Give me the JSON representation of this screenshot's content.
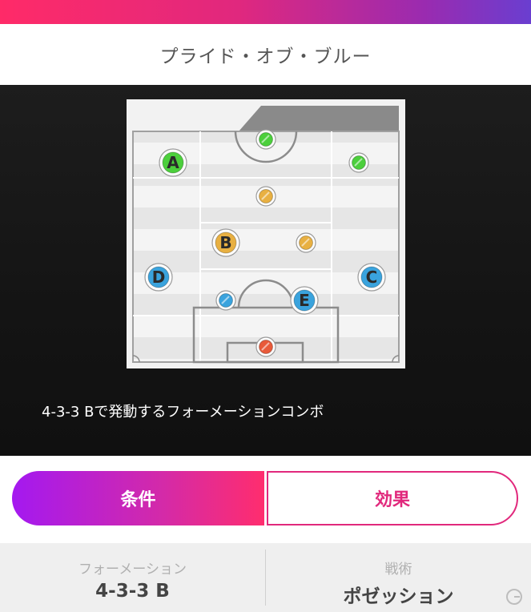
{
  "header": {
    "title": "プライド・オブ・ブルー"
  },
  "formation_preview": {
    "description": "4-3-3 Bで発動するフォーメーションコンボ",
    "players": [
      {
        "label": "",
        "color": "#4ccf3c"
      },
      {
        "label": "A",
        "color": "#4ccf3c"
      },
      {
        "label": "",
        "color": "#4ccf3c"
      },
      {
        "label": "",
        "color": "#e8b042"
      },
      {
        "label": "B",
        "color": "#e8b042"
      },
      {
        "label": "",
        "color": "#e8b042"
      },
      {
        "label": "D",
        "color": "#3aa3dd"
      },
      {
        "label": "C",
        "color": "#3aa3dd"
      },
      {
        "label": "",
        "color": "#3aa3dd"
      },
      {
        "label": "E",
        "color": "#3aa3dd"
      },
      {
        "label": "",
        "color": "#e85a3a"
      }
    ]
  },
  "tabs": {
    "condition": "条件",
    "effect": "効果"
  },
  "info": {
    "formation_label": "フォーメーション",
    "formation_value": "4-3-3 B",
    "tactics_label": "戦術",
    "tactics_value": "ポゼッション"
  },
  "colors": {
    "accent": "#e1287c",
    "gradient_start": "#a419f0",
    "gradient_end": "#ff2d6e"
  },
  "icons": {
    "watermark": "g-logo-icon"
  }
}
